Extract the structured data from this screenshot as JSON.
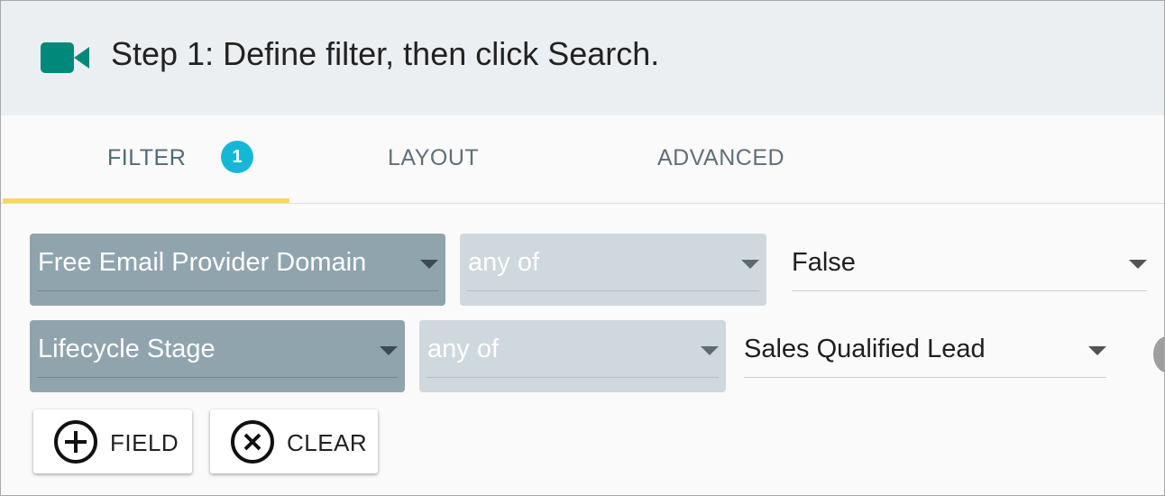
{
  "header": {
    "icon": "videocam-icon",
    "icon_color": "#00897b",
    "title": "Step 1: Define filter, then click Search."
  },
  "tabs": {
    "filter": {
      "label": "FILTER",
      "badge": "1"
    },
    "layout": {
      "label": "LAYOUT"
    },
    "advanced": {
      "label": "ADVANCED"
    },
    "active": "FILTER",
    "indicator_color": "#f9d65c",
    "badge_color": "#14b8d4"
  },
  "filters": [
    {
      "field": "Free Email Provider Domain",
      "operator": "any of",
      "value": "False"
    },
    {
      "field": "Lifecycle Stage",
      "operator": "any of",
      "value": "Sales Qualified Lead"
    }
  ],
  "actions": {
    "add_field": {
      "label": "FIELD",
      "icon": "add-circle-icon"
    },
    "clear": {
      "label": "CLEAR",
      "icon": "cancel-circle-icon"
    }
  }
}
